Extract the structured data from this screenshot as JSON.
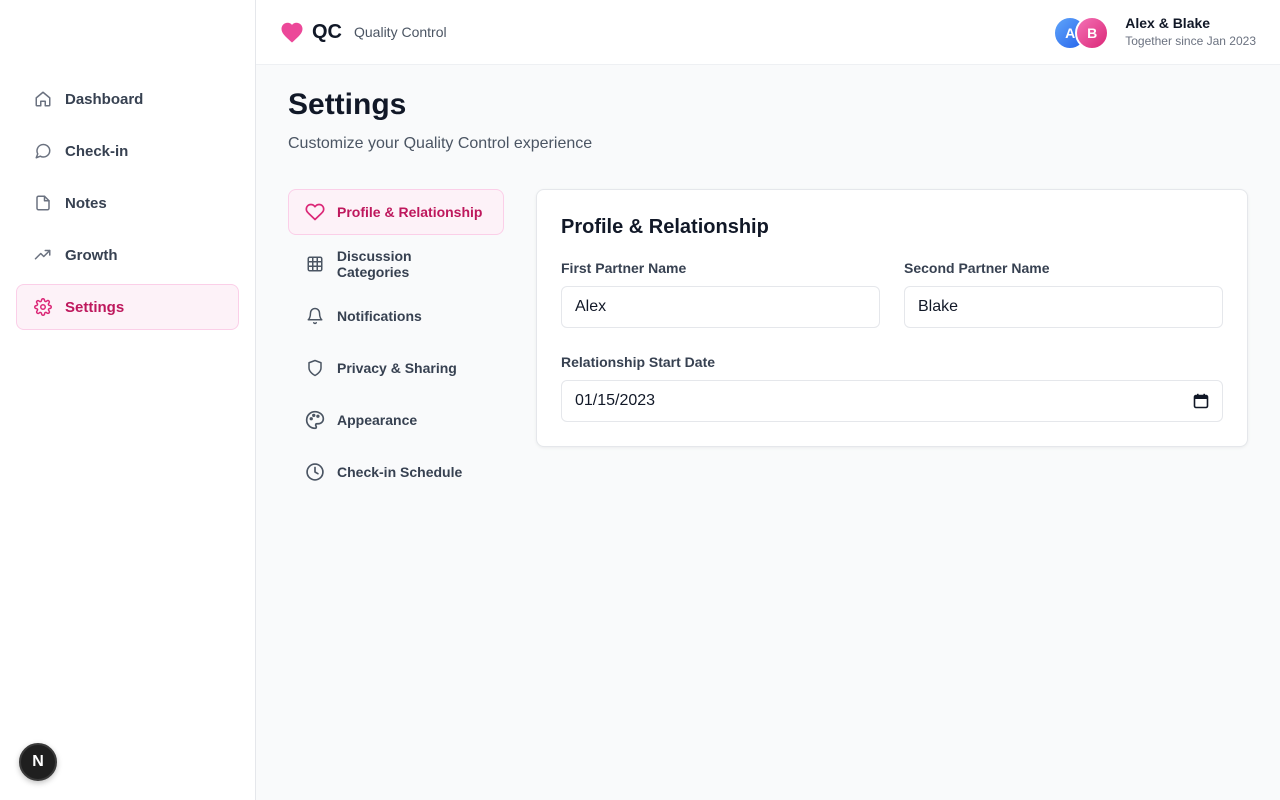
{
  "brand": {
    "logo": "QC",
    "tagline": "Quality Control",
    "accent": "#ec4899"
  },
  "user": {
    "avatar_a": "A",
    "avatar_b": "B",
    "names": "Alex & Blake",
    "since": "Together since Jan 2023"
  },
  "sidebar": {
    "items": [
      {
        "label": "Dashboard",
        "icon": "home-icon"
      },
      {
        "label": "Check-in",
        "icon": "message-circle-icon"
      },
      {
        "label": "Notes",
        "icon": "file-icon"
      },
      {
        "label": "Growth",
        "icon": "trending-up-icon"
      },
      {
        "label": "Settings",
        "icon": "gear-icon",
        "active": true
      }
    ],
    "badge": "N"
  },
  "page": {
    "title": "Settings",
    "subtitle": "Customize your Quality Control experience"
  },
  "settings_nav": {
    "items": [
      {
        "label": "Profile & Relationship",
        "icon": "heart-icon",
        "active": true
      },
      {
        "label": "Discussion Categories",
        "icon": "grid-icon"
      },
      {
        "label": "Notifications",
        "icon": "bell-icon"
      },
      {
        "label": "Privacy & Sharing",
        "icon": "shield-icon"
      },
      {
        "label": "Appearance",
        "icon": "palette-icon"
      },
      {
        "label": "Check-in Schedule",
        "icon": "clock-icon"
      }
    ]
  },
  "profile_card": {
    "title": "Profile & Relationship",
    "first_partner_label": "First Partner Name",
    "first_partner_value": "Alex",
    "second_partner_label": "Second Partner Name",
    "second_partner_value": "Blake",
    "start_date_label": "Relationship Start Date",
    "start_date_value": "01/15/2023"
  }
}
